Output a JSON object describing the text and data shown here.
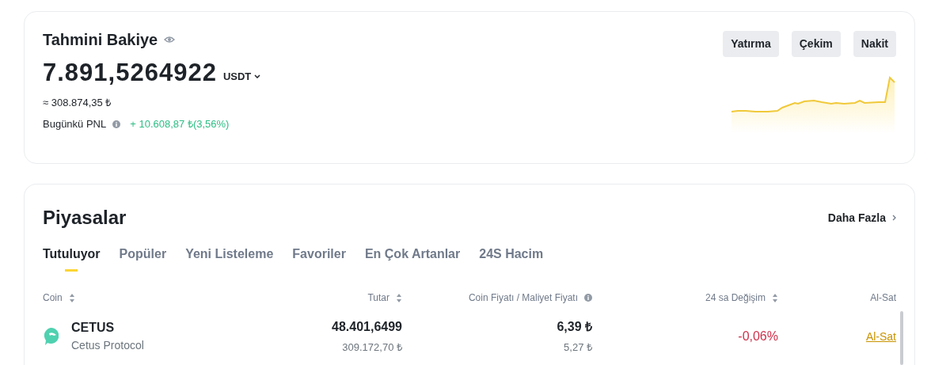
{
  "balance_card": {
    "title": "Tahmini Bakiye",
    "amount": "7.891,5264922",
    "currency": "USDT",
    "fiat_value": "≈ 308.874,35 ₺",
    "pnl_label": "Bugünkü PNL",
    "pnl_value": "+ 10.608,87 ₺(3,56%)",
    "buttons": [
      "Yatırma",
      "Çekim",
      "Nakit"
    ]
  },
  "markets": {
    "title": "Piyasalar",
    "more_link": "Daha Fazla",
    "tabs": [
      {
        "label": "Tutuluyor",
        "selected": true
      },
      {
        "label": "Popüler",
        "selected": false
      },
      {
        "label": "Yeni Listeleme",
        "selected": false
      },
      {
        "label": "Favoriler",
        "selected": false
      },
      {
        "label": "En Çok Artanlar",
        "selected": false
      },
      {
        "label": "24S Hacim",
        "selected": false
      }
    ],
    "table": {
      "columns": [
        {
          "label": "Coin",
          "kind": "sort"
        },
        {
          "label": "Tutar",
          "kind": "sort"
        },
        {
          "label": "Coin Fiyatı / Maliyet Fiyatı",
          "kind": "info"
        },
        {
          "label": "24 sa Değişim",
          "kind": "sort"
        },
        {
          "label": "Al-Sat",
          "kind": "plain"
        }
      ],
      "rows": [
        {
          "symbol": "CETUS",
          "name": "Cetus Protocol",
          "amount": "48.401,6499",
          "amount_fiat": "309.172,70 ₺",
          "price": "6,39 ₺",
          "cost": "5,27 ₺",
          "change": "-0,06%",
          "color": "#cf304a",
          "action": "Al-Sat"
        }
      ]
    }
  }
}
